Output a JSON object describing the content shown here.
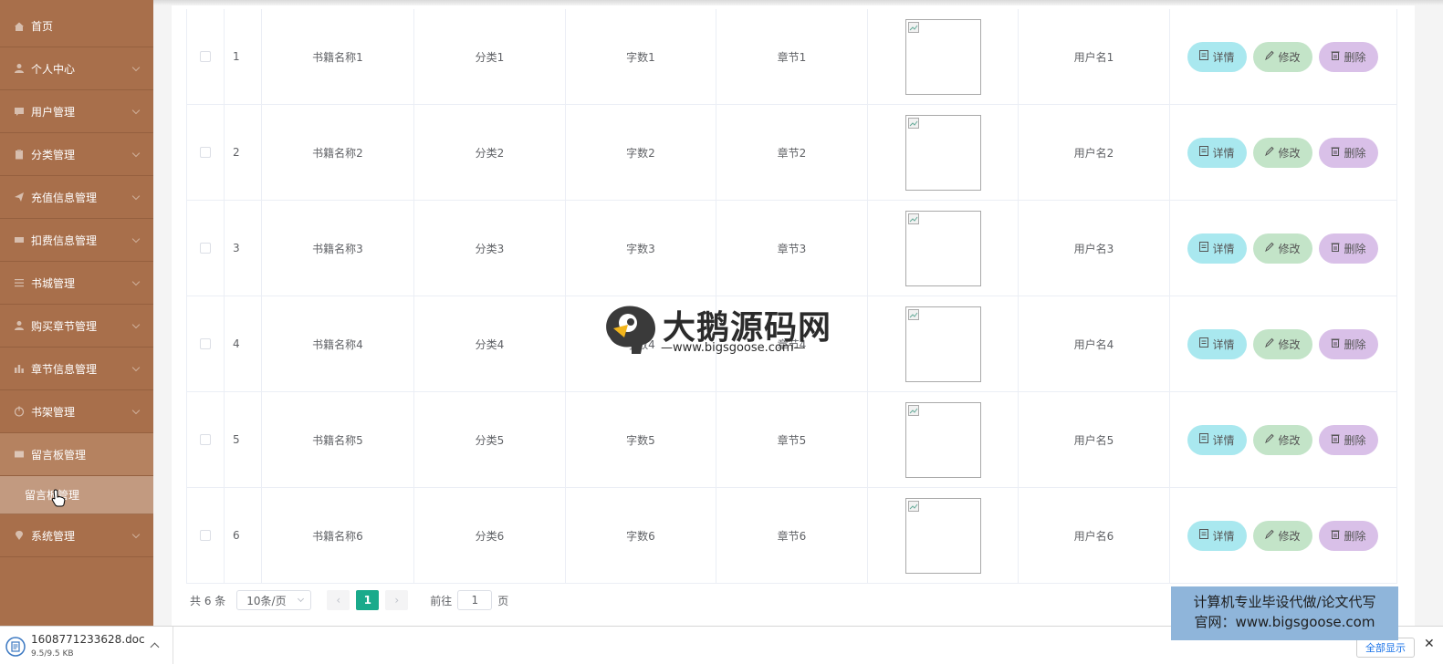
{
  "sidebar": {
    "items": [
      {
        "label": "首页",
        "icon": "home-icon",
        "chevron": false
      },
      {
        "label": "个人中心",
        "icon": "user-icon",
        "chevron": true
      },
      {
        "label": "用户管理",
        "icon": "chat-icon",
        "chevron": true
      },
      {
        "label": "分类管理",
        "icon": "clipboard-icon",
        "chevron": true
      },
      {
        "label": "充值信息管理",
        "icon": "send-icon",
        "chevron": true
      },
      {
        "label": "扣费信息管理",
        "icon": "ticket-icon",
        "chevron": true
      },
      {
        "label": "书城管理",
        "icon": "sliders-icon",
        "chevron": true
      },
      {
        "label": "购买章节管理",
        "icon": "user-icon",
        "chevron": true
      },
      {
        "label": "章节信息管理",
        "icon": "bar-chart-icon",
        "chevron": true
      },
      {
        "label": "书架管理",
        "icon": "power-icon",
        "chevron": true
      },
      {
        "label": "留言板管理",
        "icon": "message-icon",
        "chevron": false,
        "open": true
      },
      {
        "label": "系统管理",
        "icon": "location-icon",
        "chevron": true
      }
    ],
    "sub_item": "留言板管理"
  },
  "table": {
    "rows": [
      {
        "index": "1",
        "name": "书籍名称1",
        "category": "分类1",
        "words": "字数1",
        "chapter": "章节1",
        "user": "用户名1"
      },
      {
        "index": "2",
        "name": "书籍名称2",
        "category": "分类2",
        "words": "字数2",
        "chapter": "章节2",
        "user": "用户名2"
      },
      {
        "index": "3",
        "name": "书籍名称3",
        "category": "分类3",
        "words": "字数3",
        "chapter": "章节3",
        "user": "用户名3"
      },
      {
        "index": "4",
        "name": "书籍名称4",
        "category": "分类4",
        "words": "字数4",
        "chapter": "章节4",
        "user": "用户名4"
      },
      {
        "index": "5",
        "name": "书籍名称5",
        "category": "分类5",
        "words": "字数5",
        "chapter": "章节5",
        "user": "用户名5"
      },
      {
        "index": "6",
        "name": "书籍名称6",
        "category": "分类6",
        "words": "字数6",
        "chapter": "章节6",
        "user": "用户名6"
      }
    ],
    "actions": {
      "detail": "详情",
      "edit": "修改",
      "delete": "删除"
    }
  },
  "pagination": {
    "total": "共 6 条",
    "page_size": "10条/页",
    "prev": "‹",
    "current_page": "1",
    "next": "›",
    "goto_label": "前往",
    "goto_value": "1",
    "page_unit": "页"
  },
  "watermark": {
    "title": "大鹅源码网",
    "url": "—www.bigsgoose.com—"
  },
  "ad": {
    "line1": "计算机专业毕设代做/论文代写",
    "line2": "官网：www.bigsgoose.com"
  },
  "download_bar": {
    "filename": "1608771233628.doc",
    "size": "9.5/9.5 KB",
    "show_all": "全部显示",
    "close": "✕"
  },
  "colors": {
    "sidebar_bg": "#a86f4b",
    "accent": "#1aaa8b",
    "detail_btn": "#a9e8ef",
    "edit_btn": "#c3e4c8",
    "delete_btn": "#d9c0e8"
  }
}
